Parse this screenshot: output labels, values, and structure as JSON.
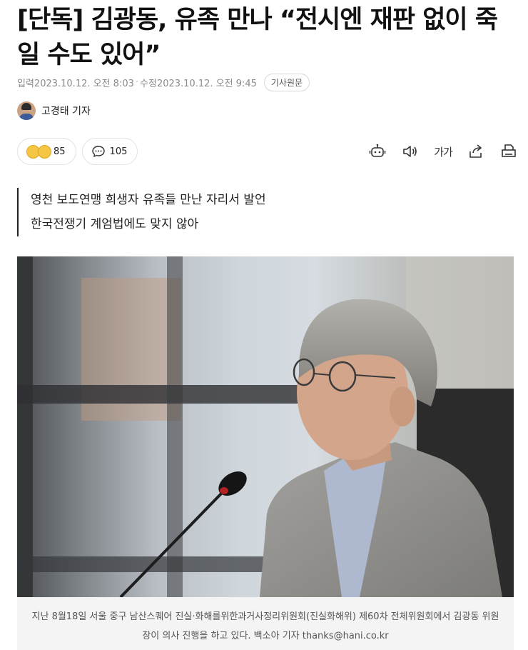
{
  "article": {
    "title": "[단독] 김광동, 유족 만나 “전시엔 재판 없이 죽일 수도 있어”",
    "meta": {
      "published_label": "입력",
      "published_time": "2023.10.12. 오전 8:03",
      "modified_label": "수정",
      "modified_time": "2023.10.12. 오전 9:45",
      "original_button": "기사원문"
    },
    "author": "고경태 기자",
    "reactions": {
      "like_count": "85",
      "comment_count": "105"
    },
    "font_size_label": "가가",
    "summary": [
      "영천 보도연맹 희생자 유족들 만난 자리서 발언",
      "한국전쟁기 계엄법에도 맞지 않아"
    ],
    "photo_caption": "지난 8월18일 서울 중구 남산스퀘어 진실·화해를위한과거사정리위원회(진실화해위) 제60차 전체위원회에서 김광동 위원장이 의사 진행을 하고 있다. 백소아 기자 thanks@hani.co.kr"
  },
  "icons": [
    "robot-icon",
    "speaker-icon",
    "font-size-icon",
    "share-icon",
    "print-icon",
    "comment-icon"
  ]
}
